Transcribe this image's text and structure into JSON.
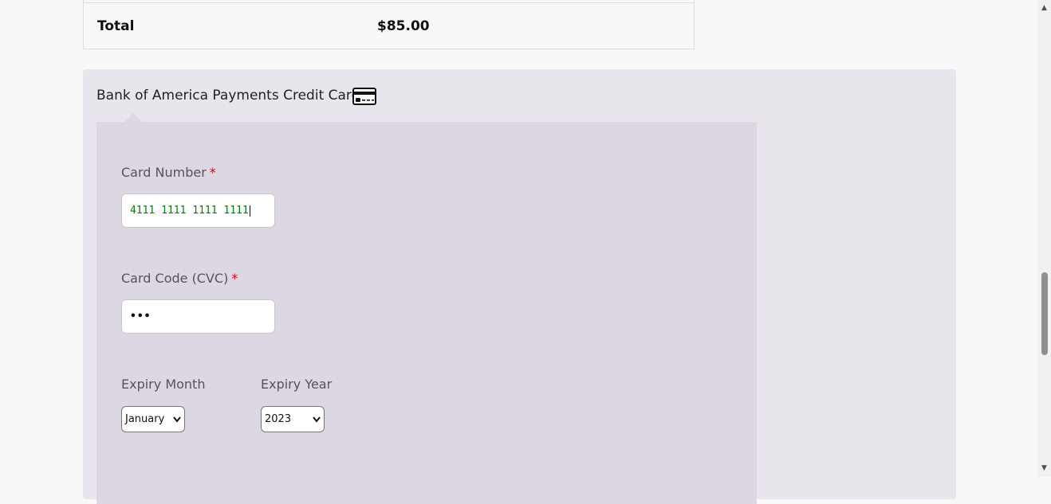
{
  "order_summary": {
    "total_label": "Total",
    "total_value": "$85.00"
  },
  "payment": {
    "method_label": "Bank of America Payments Credit Card",
    "method_icon": "credit-card-icon",
    "card_number": {
      "label": "Card Number",
      "required_mark": "*",
      "value": "4111 1111 1111 1111"
    },
    "card_code": {
      "label": "Card Code (CVC)",
      "required_mark": "*",
      "value": "•••"
    },
    "expiry_month": {
      "label": "Expiry Month",
      "selected": "January"
    },
    "expiry_year": {
      "label": "Expiry Year",
      "selected": "2023"
    }
  },
  "colors": {
    "panel_outer": "#e8e6ec",
    "panel_inner": "#dcd7e2",
    "required": "#d0021b",
    "card_number_text": "#0a7a0a"
  }
}
